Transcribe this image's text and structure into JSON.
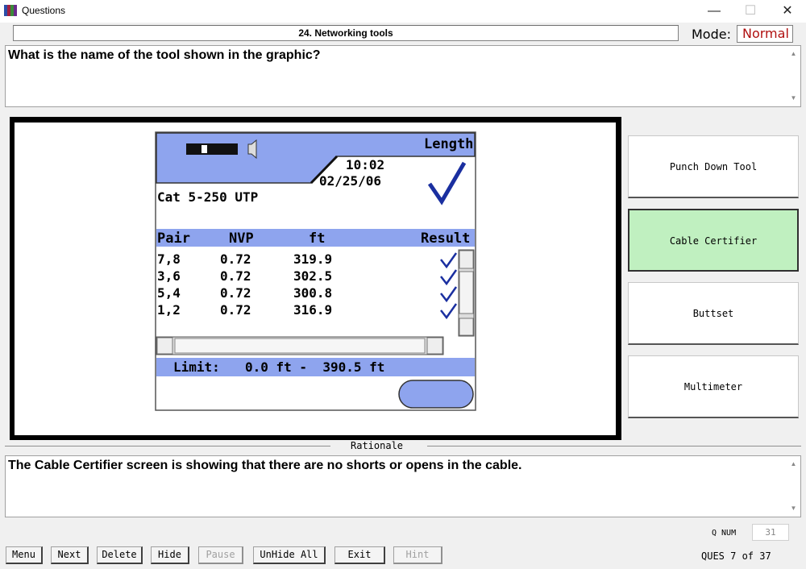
{
  "window": {
    "title": "Questions",
    "minimize": "—",
    "maximize": "☐",
    "close": "✕"
  },
  "topic": "24. Networking tools",
  "mode": {
    "label": "Mode:",
    "value": "Normal"
  },
  "question": "What is the name of the tool shown in the graphic?",
  "graphic": {
    "header": "Length",
    "time": "10:02",
    "date": "02/25/06",
    "cable_type": "Cat 5-250 UTP",
    "columns": [
      "Pair",
      "NVP",
      "ft",
      "Result"
    ],
    "rows": [
      {
        "pair": "7,8",
        "nvp": "0.72",
        "ft": "319.9"
      },
      {
        "pair": "3,6",
        "nvp": "0.72",
        "ft": "302.5"
      },
      {
        "pair": "5,4",
        "nvp": "0.72",
        "ft": "300.8"
      },
      {
        "pair": "1,2",
        "nvp": "0.72",
        "ft": "316.9"
      }
    ],
    "limit_label": "Limit:",
    "limit_value": "0.0 ft -  390.5 ft"
  },
  "answers": [
    {
      "label": "Punch Down Tool",
      "selected": false
    },
    {
      "label": "Cable Certifier",
      "selected": true
    },
    {
      "label": "Buttset",
      "selected": false
    },
    {
      "label": "Multimeter",
      "selected": false
    }
  ],
  "rationale": {
    "label": "Rationale",
    "text": "The Cable Certifier screen is showing that there are no shorts or opens in the cable."
  },
  "qnum": {
    "label": "Q NUM",
    "value": "31"
  },
  "buttons": {
    "menu": "Menu",
    "next": "Next",
    "delete": "Delete",
    "hide": "Hide",
    "pause": "Pause",
    "unhide_all": "UnHide All",
    "exit": "Exit",
    "hint": "Hint"
  },
  "status": "QUES 7 of 37",
  "colors": {
    "selected_answer": "#c0f0c0",
    "mode_value": "#b01010",
    "screen_band": "#8ea4ee",
    "check": "#1a2fa0"
  }
}
